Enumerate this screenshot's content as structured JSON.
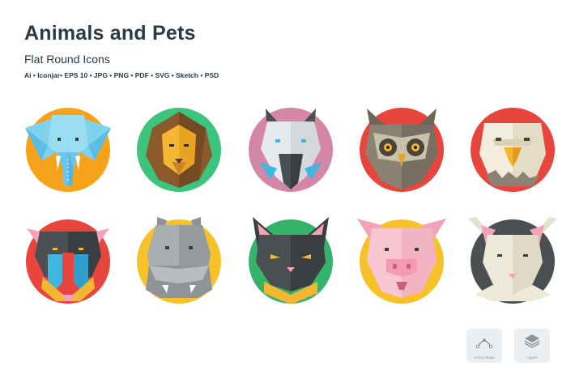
{
  "header": {
    "title": "Animals and Pets",
    "subtitle": "Flat Round Icons",
    "formats": "Ai • Iconjar• EPS 10 • JPG • PNG • PDF • SVG • Sketch • PSD"
  },
  "icons": [
    {
      "animal": "elephant",
      "circle_color": "#f7a21b"
    },
    {
      "animal": "lion",
      "circle_color": "#3cc47c"
    },
    {
      "animal": "wolf",
      "circle_color": "#d386a5"
    },
    {
      "animal": "owl",
      "circle_color": "#e8453c"
    },
    {
      "animal": "eagle",
      "circle_color": "#e8453c"
    },
    {
      "animal": "mandrill",
      "circle_color": "#e8453c"
    },
    {
      "animal": "hippo",
      "circle_color": "#f7c12a"
    },
    {
      "animal": "cat",
      "circle_color": "#35b36a"
    },
    {
      "animal": "pig",
      "circle_color": "#f7c12a"
    },
    {
      "animal": "goat",
      "circle_color": "#4a4f52"
    }
  ],
  "badges": [
    {
      "label": "vector shape",
      "icon": "vector-pen-icon"
    },
    {
      "label": "Layers",
      "icon": "layers-icon"
    }
  ]
}
